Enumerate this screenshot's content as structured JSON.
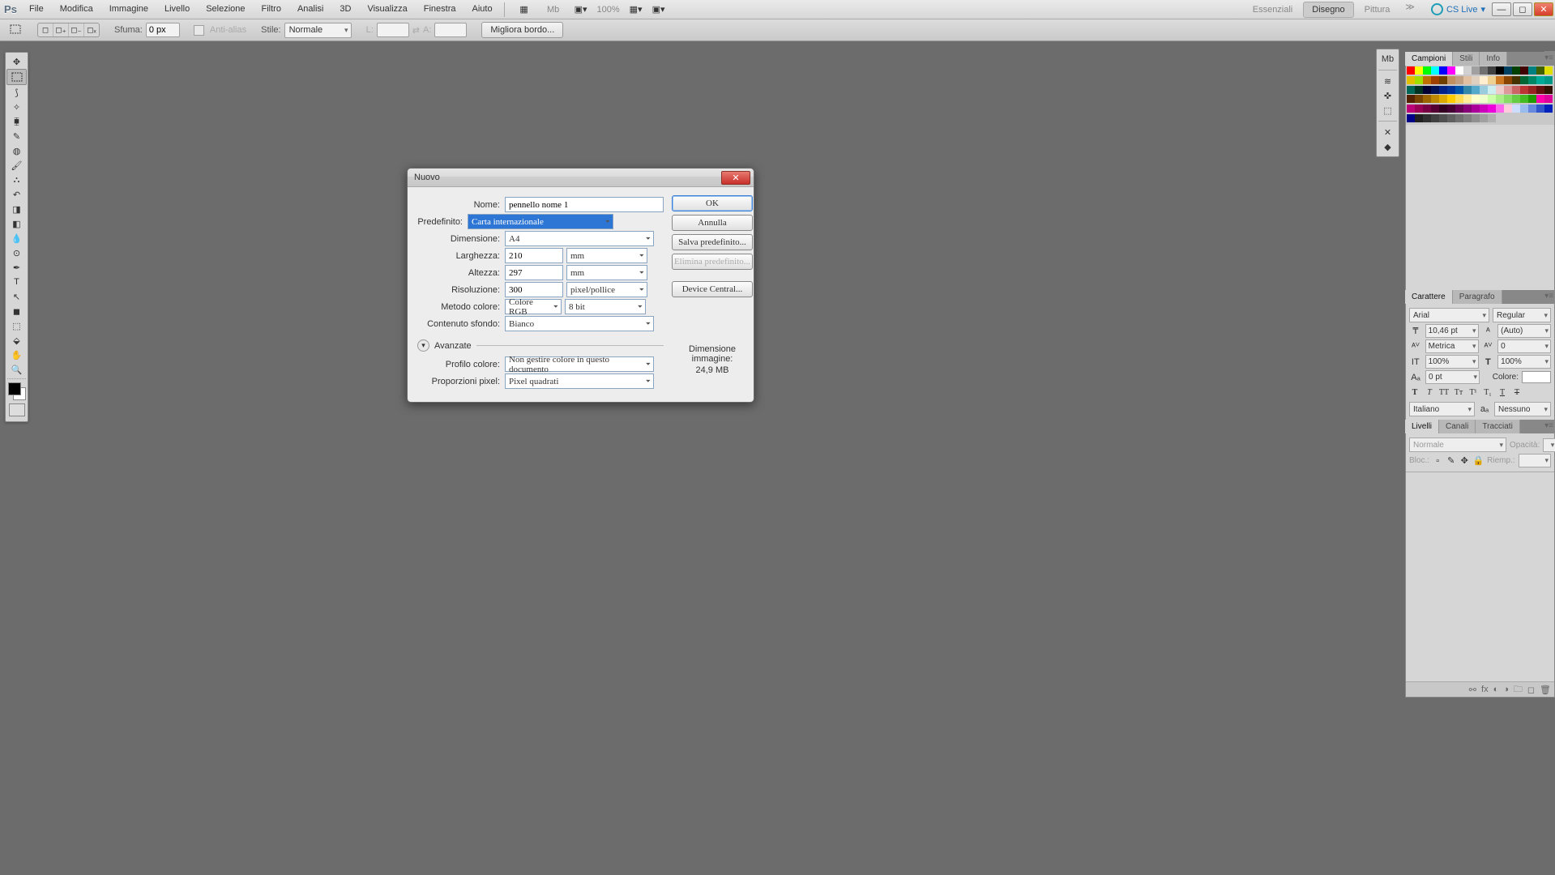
{
  "menu": {
    "items": [
      "File",
      "Modifica",
      "Immagine",
      "Livello",
      "Selezione",
      "Filtro",
      "Analisi",
      "3D",
      "Visualizza",
      "Finestra",
      "Aiuto"
    ],
    "zoom": "100%"
  },
  "workspace": {
    "tabs": [
      "Essenziali",
      "Disegno",
      "Pittura"
    ],
    "cslive": "CS Live"
  },
  "opt": {
    "sfuma": "Sfuma:",
    "sfuma_val": "0 px",
    "aa": "Anti-alias",
    "stile": "Stile:",
    "stile_val": "Normale",
    "l": "L:",
    "a": "A:",
    "btn": "Migliora bordo..."
  },
  "panels": {
    "campioni_tabs": [
      "Campioni",
      "Stili",
      "Info"
    ],
    "car_tabs": [
      "Carattere",
      "Paragrafo"
    ],
    "car": {
      "font": "Arial",
      "style": "Regular",
      "size": "10,46 pt",
      "leading": "(Auto)",
      "tracking": "Metrica",
      "kerning": "0",
      "vscale": "100%",
      "hscale": "100%",
      "baseline": "0 pt",
      "color_lbl": "Colore:",
      "lang": "Italiano",
      "aa": "Nessuno"
    },
    "liv_tabs": [
      "Livelli",
      "Canali",
      "Tracciati"
    ],
    "liv": {
      "mode": "Normale",
      "opac": "Opacità:",
      "lock": "Bloc.:",
      "fill": "Riemp.:"
    }
  },
  "dlg": {
    "title": "Nuovo",
    "nome_l": "Nome:",
    "nome": "pennello nome 1",
    "pre_l": "Predefinito:",
    "pre": "Carta internazionale",
    "dim_l": "Dimensione:",
    "dim": "A4",
    "w_l": "Larghezza:",
    "w": "210",
    "w_u": "mm",
    "h_l": "Altezza:",
    "h": "297",
    "h_u": "mm",
    "res_l": "Risoluzione:",
    "res": "300",
    "res_u": "pixel/pollice",
    "cm_l": "Metodo colore:",
    "cm": "Colore RGB",
    "cm_b": "8 bit",
    "bg_l": "Contenuto sfondo:",
    "bg": "Bianco",
    "adv": "Avanzate",
    "cp_l": "Profilo colore:",
    "cp": "Non gestire colore in questo documento",
    "pp_l": "Proporzioni pixel:",
    "pp": "Pixel quadrati",
    "ok": "OK",
    "cancel": "Annulla",
    "savep": "Salva predefinito...",
    "delp": "Elimina predefinito...",
    "dc": "Device Central...",
    "imgsz_l": "Dimensione immagine:",
    "imgsz": "24,9 MB"
  },
  "swatches": [
    "#f00",
    "#ff0",
    "#0f0",
    "#0ff",
    "#00f",
    "#f0f",
    "#fff",
    "#d0d0d0",
    "#a0a0a0",
    "#707070",
    "#404040",
    "#000",
    "#004060",
    "#004000",
    "#400000",
    "#008080",
    "#406000",
    "#e0e000",
    "#e0c000",
    "#a0e000",
    "#c07000",
    "#a04000",
    "#704000",
    "#c09060",
    "#c0a080",
    "#e0c0a0",
    "#e0d0c0",
    "#ffeed0",
    "#eed090",
    "#cc7722",
    "#884400",
    "#443300",
    "#006633",
    "#008866",
    "#00aa99",
    "#009988",
    "#006655",
    "#003322",
    "#000033",
    "#001155",
    "#002288",
    "#003399",
    "#0055aa",
    "#3388aa",
    "#55aacc",
    "#99ccdd",
    "#cceeee",
    "#eecccc",
    "#dd9999",
    "#cc6666",
    "#bb3333",
    "#992222",
    "#661111",
    "#331100",
    "#552200",
    "#774400",
    "#996600",
    "#bb8800",
    "#ddaa00",
    "#ffcc00",
    "#ffdd55",
    "#ffee99",
    "#ffffcc",
    "#eeffcc",
    "#ccffaa",
    "#aaee88",
    "#88dd66",
    "#66cc44",
    "#44bb22",
    "#229900",
    "#ff00aa",
    "#dd0099",
    "#bb0077",
    "#990055",
    "#770044",
    "#550033",
    "#330022",
    "#440033",
    "#660055",
    "#880077",
    "#aa0099",
    "#cc00bb",
    "#ee00dd",
    "#ff66ee",
    "#ffccdd",
    "#ccddff",
    "#99bbee",
    "#6688dd",
    "#3355cc",
    "#0022bb",
    "#000088",
    "#202020",
    "#303030",
    "#404040",
    "#505050",
    "#606060",
    "#707070",
    "#808080",
    "#909090",
    "#a0a0a0",
    "#b0b0b0"
  ]
}
